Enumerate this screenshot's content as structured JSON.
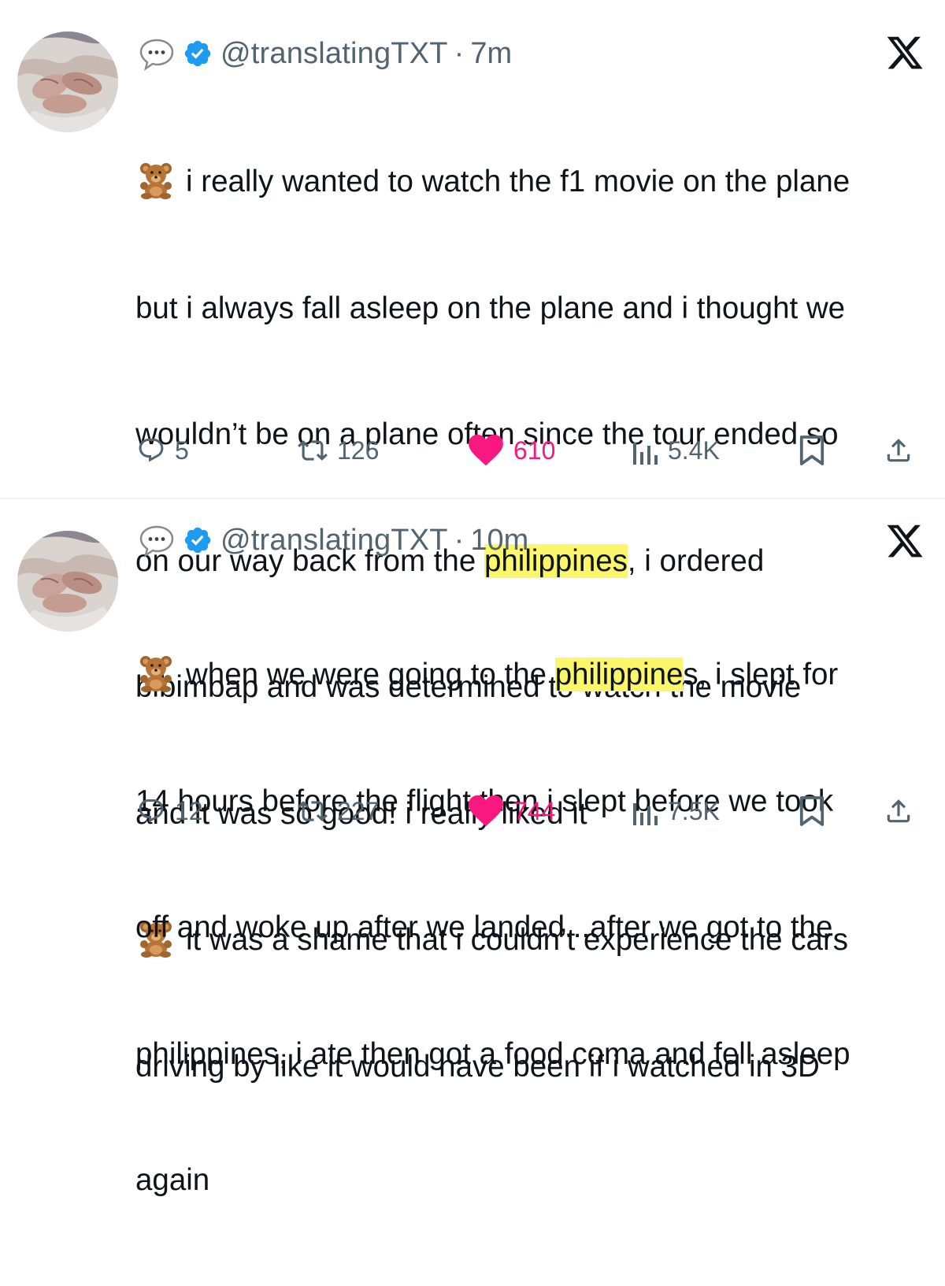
{
  "colors": {
    "text": "#0f1419",
    "muted": "#536471",
    "verified": "#1d9bf0",
    "like": "#f91880",
    "highlight": "#fbf66a"
  },
  "tweets": [
    {
      "handle": "@translatingTXT",
      "separator": "·",
      "time": "7m",
      "icons": [
        "speech-bubble-icon",
        "verified-badge-icon",
        "x-logo-icon"
      ],
      "lines": [
        {
          "bear": true,
          "text": "i really wanted to watch the f1 movie on the plane"
        },
        {
          "text": "but i always fall asleep on the plane and i thought we"
        },
        {
          "text": "wouldn’t be on a plane often since the tour ended so"
        },
        {
          "pre": "on our way back from the ",
          "highlight": "philippines",
          "post": ", i ordered"
        },
        {
          "text": "bibimbap and was determined to watch the movie"
        },
        {
          "text": "and it was so good! i really liked it"
        },
        {
          "bear": true,
          "text": "it was a shame that i couldn’t experience the cars"
        },
        {
          "text": "driving by like it would have been if i watched in 3D"
        }
      ],
      "actions": {
        "replies": "5",
        "retweets": "126",
        "likes": "610",
        "views": "5.4K"
      }
    },
    {
      "handle": "@translatingTXT",
      "separator": "·",
      "time": "10m",
      "icons": [
        "speech-bubble-icon",
        "verified-badge-icon",
        "x-logo-icon"
      ],
      "lines": [
        {
          "bear": true,
          "pre": "when we were going to the ",
          "highlight": "philippine",
          "post": "s, i slept for"
        },
        {
          "text": "14 hours before the flight then i slept before we took"
        },
        {
          "text": "off and woke up after we landed...after we got to the"
        },
        {
          "text": "philippines, i ate then got a food coma and fell asleep"
        },
        {
          "text": "again"
        }
      ],
      "actions": {
        "replies": "12",
        "retweets": "227",
        "likes": "744",
        "views": "7.5K"
      }
    }
  ]
}
